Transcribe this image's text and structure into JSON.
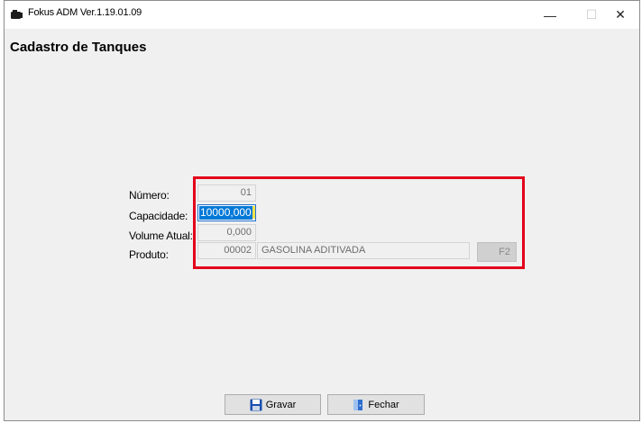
{
  "window": {
    "title": "Fokus ADM Ver.1.19.01.09",
    "min_glyph": "—",
    "max_glyph": "☐",
    "close_glyph": "✕"
  },
  "page": {
    "title": "Cadastro de Tanques"
  },
  "form": {
    "numero": {
      "label": "Número:",
      "value": "01"
    },
    "capacidade": {
      "label": "Capacidade:",
      "value": "10000,000"
    },
    "volume_atual": {
      "label": "Volume Atual:",
      "value": "0,000"
    },
    "produto": {
      "label": "Produto:",
      "code": "00002",
      "name": "GASOLINA ADITIVADA",
      "lookup_label": "F2"
    }
  },
  "buttons": {
    "gravar": {
      "label": "Gravar",
      "icon": "floppy-disk-icon"
    },
    "fechar": {
      "label": "Fechar",
      "icon": "door-exit-icon"
    }
  },
  "colors": {
    "highlight": "#e3001b",
    "selection": "#0078d7",
    "window_bg": "#f0f0f0"
  }
}
